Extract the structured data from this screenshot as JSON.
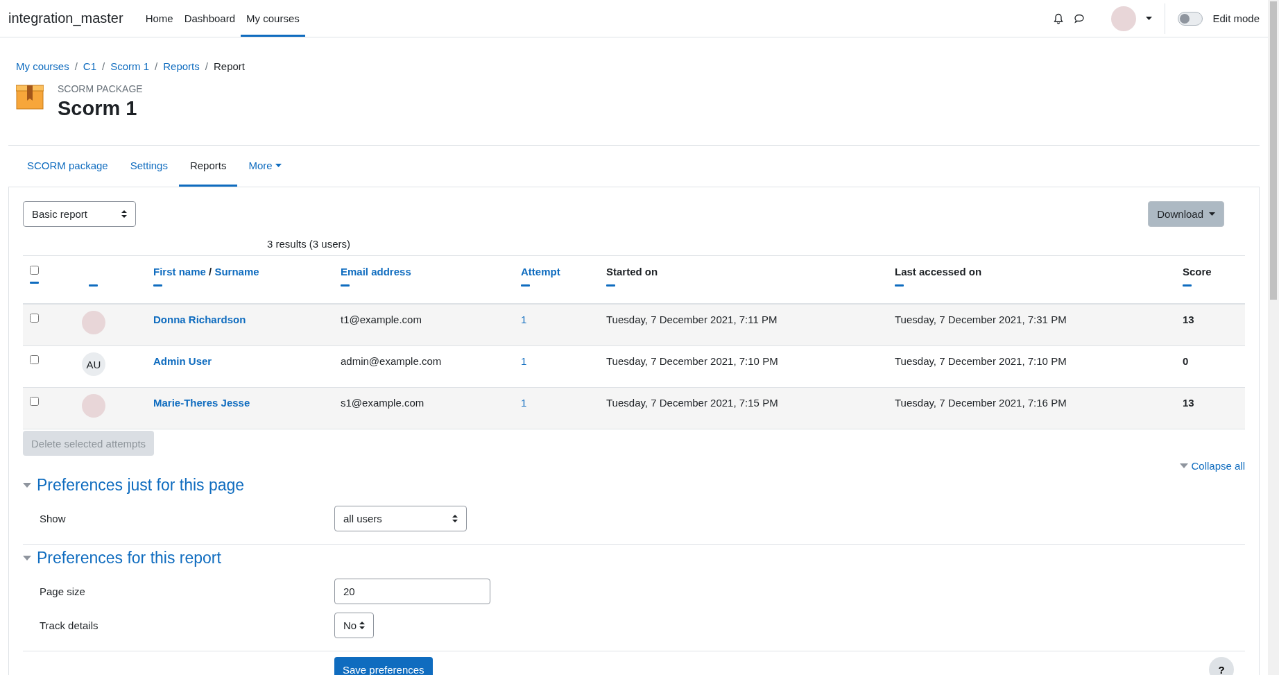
{
  "navbar": {
    "site_name": "integration_master",
    "links": [
      {
        "label": "Home",
        "selected": false
      },
      {
        "label": "Dashboard",
        "selected": false
      },
      {
        "label": "My courses",
        "selected": true
      }
    ],
    "edit_mode": {
      "label": "Edit mode",
      "on": false
    }
  },
  "breadcrumb_separator": "/",
  "breadcrumb": [
    {
      "label": "My courses",
      "link": true
    },
    {
      "label": "C1",
      "link": true
    },
    {
      "label": "Scorm 1",
      "link": true
    },
    {
      "label": "Reports",
      "link": true
    },
    {
      "label": "Report",
      "link": false
    }
  ],
  "header": {
    "kicker": "SCORM PACKAGE",
    "title": "Scorm 1"
  },
  "tabs": [
    {
      "label": "SCORM package",
      "selected": false,
      "dropdown": false
    },
    {
      "label": "Settings",
      "selected": false,
      "dropdown": false
    },
    {
      "label": "Reports",
      "selected": true,
      "dropdown": false
    },
    {
      "label": "More",
      "selected": false,
      "dropdown": true
    }
  ],
  "report_select": {
    "value": "Basic report"
  },
  "download_button": "Download",
  "results": "3 results (3 users)",
  "table": {
    "select_all": {
      "checked": false
    },
    "columns": [
      {
        "kind": "checkbox"
      },
      {
        "kind": "blank"
      },
      {
        "kind": "name",
        "label": "First name",
        "separator": "/",
        "label2": "Surname"
      },
      {
        "kind": "link",
        "label": "Email address"
      },
      {
        "kind": "link",
        "label": "Attempt"
      },
      {
        "kind": "plain",
        "label": "Started on"
      },
      {
        "kind": "plain",
        "label": "Last accessed on"
      },
      {
        "kind": "plain",
        "label": "Score"
      }
    ],
    "rows": [
      {
        "checked": false,
        "avatar": {
          "kind": "photo"
        },
        "name": "Donna Richardson",
        "email": "t1@example.com",
        "attempt": "1",
        "started": "Tuesday, 7 December 2021, 7:11 PM",
        "last": "Tuesday, 7 December 2021, 7:31 PM",
        "score": "13"
      },
      {
        "checked": false,
        "avatar": {
          "kind": "initials",
          "initials": "AU"
        },
        "name": "Admin User",
        "email": "admin@example.com",
        "attempt": "1",
        "started": "Tuesday, 7 December 2021, 7:10 PM",
        "last": "Tuesday, 7 December 2021, 7:10 PM",
        "score": "0"
      },
      {
        "checked": false,
        "avatar": {
          "kind": "photo"
        },
        "name": "Marie-Theres Jesse",
        "email": "s1@example.com",
        "attempt": "1",
        "started": "Tuesday, 7 December 2021, 7:15 PM",
        "last": "Tuesday, 7 December 2021, 7:16 PM",
        "score": "13"
      }
    ]
  },
  "delete_button": {
    "label": "Delete selected attempts",
    "disabled": true
  },
  "collapse_all": "Collapse all",
  "sections": [
    {
      "title": "Preferences just for this page",
      "expanded": true,
      "fields": [
        {
          "kind": "select",
          "label": "Show",
          "value": "all users"
        }
      ]
    },
    {
      "title": "Preferences for this report",
      "expanded": true,
      "fields": [
        {
          "kind": "input",
          "label": "Page size",
          "value": "20"
        },
        {
          "kind": "select",
          "label": "Track details",
          "value": "No"
        }
      ]
    }
  ],
  "save_button": "Save preferences",
  "help_button": "?"
}
